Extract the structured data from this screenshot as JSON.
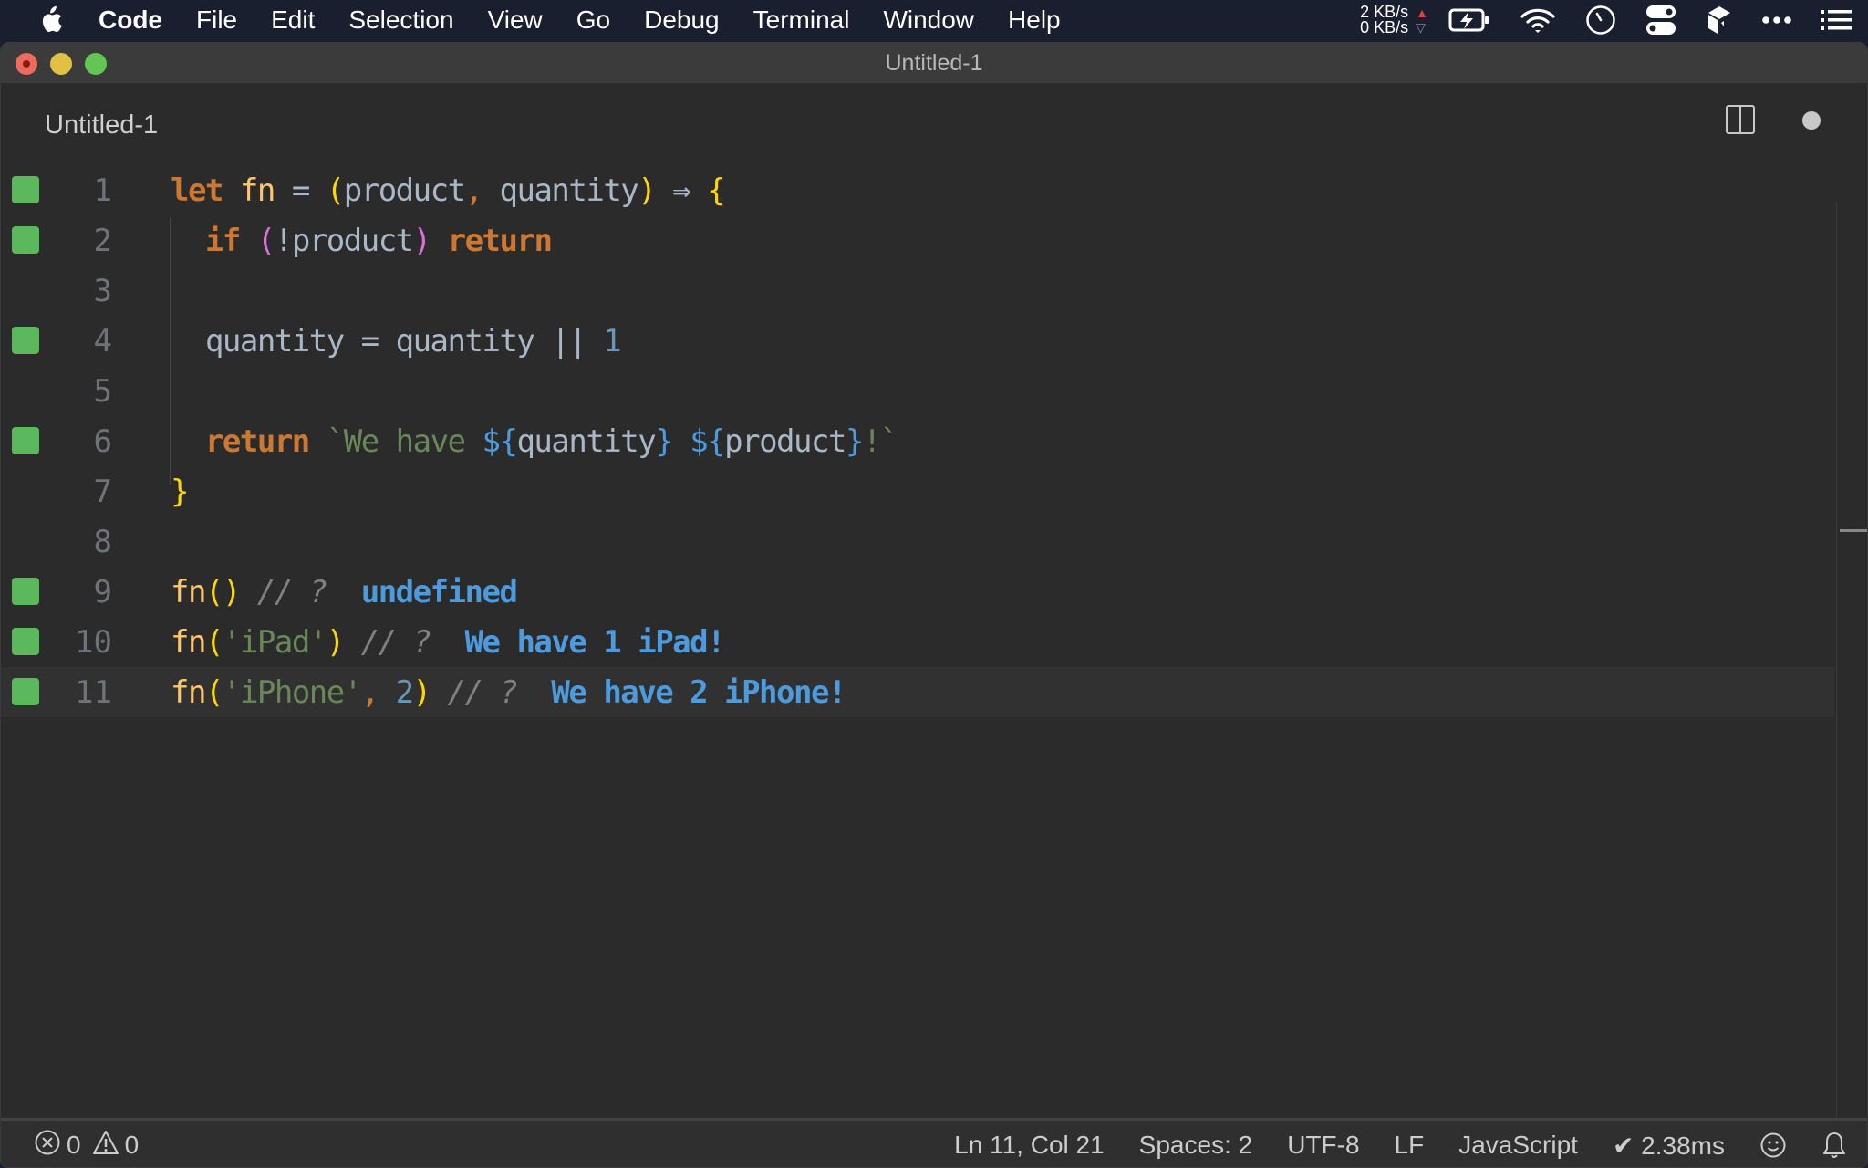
{
  "menubar": {
    "app_name": "Code",
    "items": [
      "File",
      "Edit",
      "Selection",
      "View",
      "Go",
      "Debug",
      "Terminal",
      "Window",
      "Help"
    ],
    "net_up": "2 KB/s",
    "net_down": "0 KB/s",
    "tray_icons": [
      "battery-charging-icon",
      "wifi-icon",
      "clock-icon",
      "toggles-icon",
      "box-icon",
      "more-icon",
      "list-icon"
    ]
  },
  "window": {
    "title": "Untitled-1"
  },
  "tab": {
    "label": "Untitled-1"
  },
  "editor": {
    "lines": [
      {
        "n": "1",
        "marker": true
      },
      {
        "n": "2",
        "marker": true
      },
      {
        "n": "3",
        "marker": false
      },
      {
        "n": "4",
        "marker": true
      },
      {
        "n": "5",
        "marker": false
      },
      {
        "n": "6",
        "marker": true
      },
      {
        "n": "7",
        "marker": false
      },
      {
        "n": "8",
        "marker": false
      },
      {
        "n": "9",
        "marker": true
      },
      {
        "n": "10",
        "marker": true
      },
      {
        "n": "11",
        "marker": true
      }
    ],
    "code": {
      "l1": {
        "let": "let",
        "fn": "fn",
        "eq": " = ",
        "lp": "(",
        "params": "product",
        "comma": ", ",
        "p2": "quantity",
        "rp": ")",
        "arrow": " ⇒ ",
        "brace": "{"
      },
      "l2": {
        "if": "if",
        "lp": "(",
        "cond": "!product",
        "rp": ")",
        "ret": "return"
      },
      "l4": {
        "lhs": "quantity = quantity ",
        "or": "||",
        "num": "1"
      },
      "l6": {
        "ret": "return",
        "s1": "`We have ",
        "t1": "${",
        "v1": "quantity",
        "t2": "}",
        "sp": " ",
        "t3": "${",
        "v2": "product",
        "t4": "}",
        "s2": "!`"
      },
      "l7": {
        "brace": "}"
      },
      "l9": {
        "fn": "fn",
        "lp": "(",
        "rp": ")",
        "cmt": " // ? ",
        "result": " undefined"
      },
      "l10": {
        "fn": "fn",
        "lp": "(",
        "arg": "'iPad'",
        "rp": ")",
        "cmt": " // ? ",
        "result": " We have 1 iPad!"
      },
      "l11": {
        "fn": "fn",
        "lp": "(",
        "arg": "'iPhone'",
        "comma": ",",
        "num": " 2",
        "rp": ")",
        "cmt": " // ? ",
        "result": " We have 2 iPhone!"
      }
    }
  },
  "statusbar": {
    "errors": "0",
    "warnings": "0",
    "position": "Ln 11, Col 21",
    "spaces": "Spaces: 2",
    "encoding": "UTF-8",
    "eol": "LF",
    "language": "JavaScript",
    "timing": "✔ 2.38ms"
  }
}
